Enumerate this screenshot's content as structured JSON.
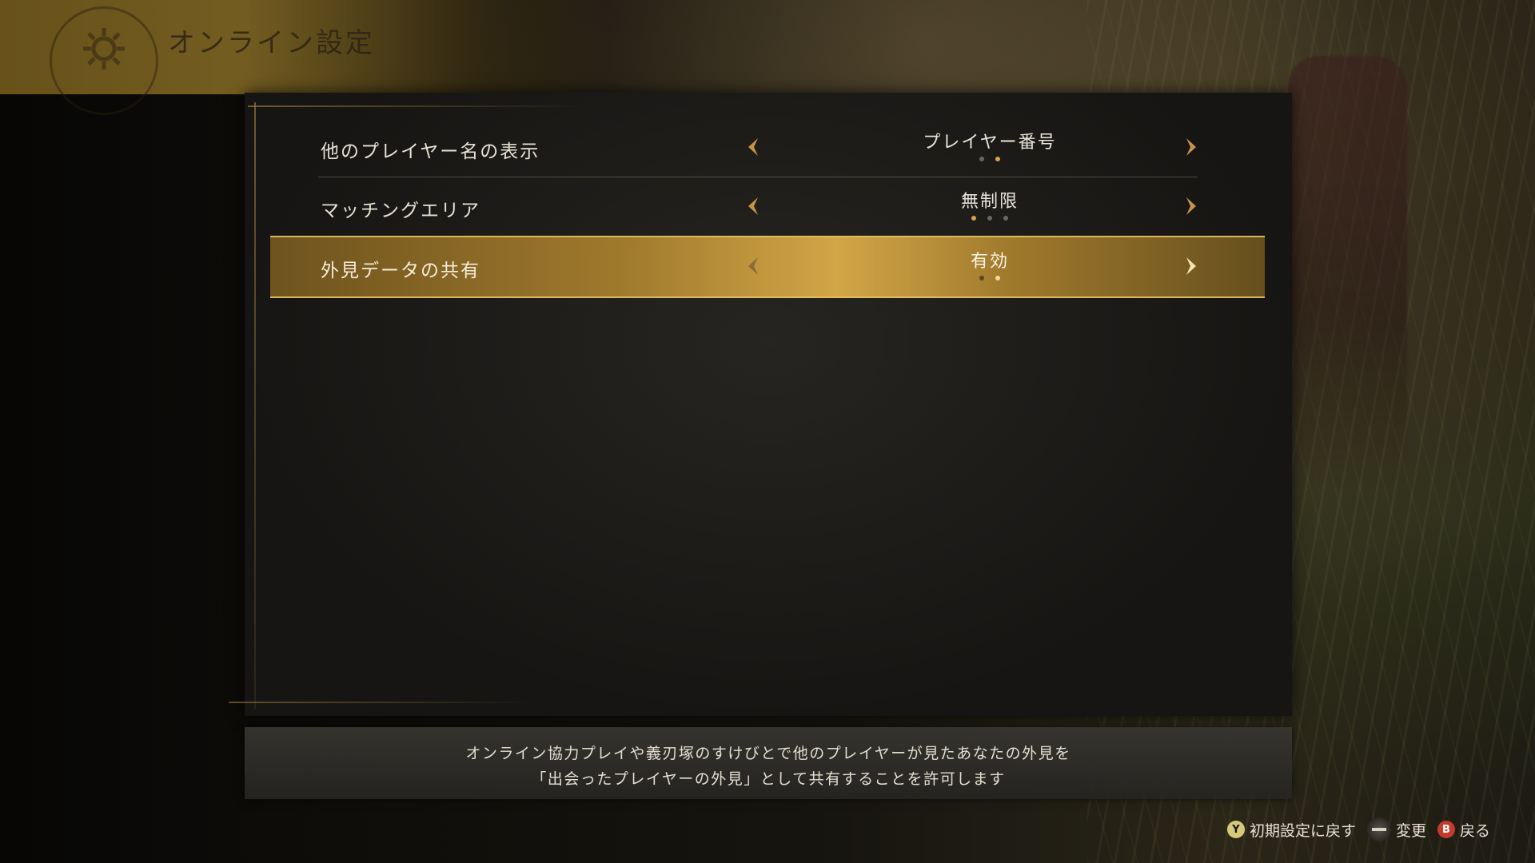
{
  "header": {
    "title": "オンライン設定",
    "emblem_icon": "gear-emblem-icon"
  },
  "settings": [
    {
      "label": "他のプレイヤー名の表示",
      "value": "プレイヤー番号",
      "option_count": 2,
      "selected_index": 1,
      "focused": false
    },
    {
      "label": "マッチングエリア",
      "value": "無制限",
      "option_count": 3,
      "selected_index": 0,
      "focused": false
    },
    {
      "label": "外見データの共有",
      "value": "有効",
      "option_count": 2,
      "selected_index": 1,
      "focused": true
    }
  ],
  "description": {
    "line1": "オンライン協力プレイや義刃塚のすけびとで他のプレイヤーが見たあなたの外見を",
    "line2": "「出会ったプレイヤーの外見」として共有することを許可します"
  },
  "footer": {
    "reset": {
      "button": "Y",
      "label": "初期設定に戻す"
    },
    "change": {
      "button": "dpad",
      "label": "変更"
    },
    "back": {
      "button": "B",
      "label": "戻る"
    }
  },
  "colors": {
    "accent_gold": "#d9a24a",
    "highlight_bar": "#c99a45",
    "panel_bg": "#1c1b18"
  }
}
